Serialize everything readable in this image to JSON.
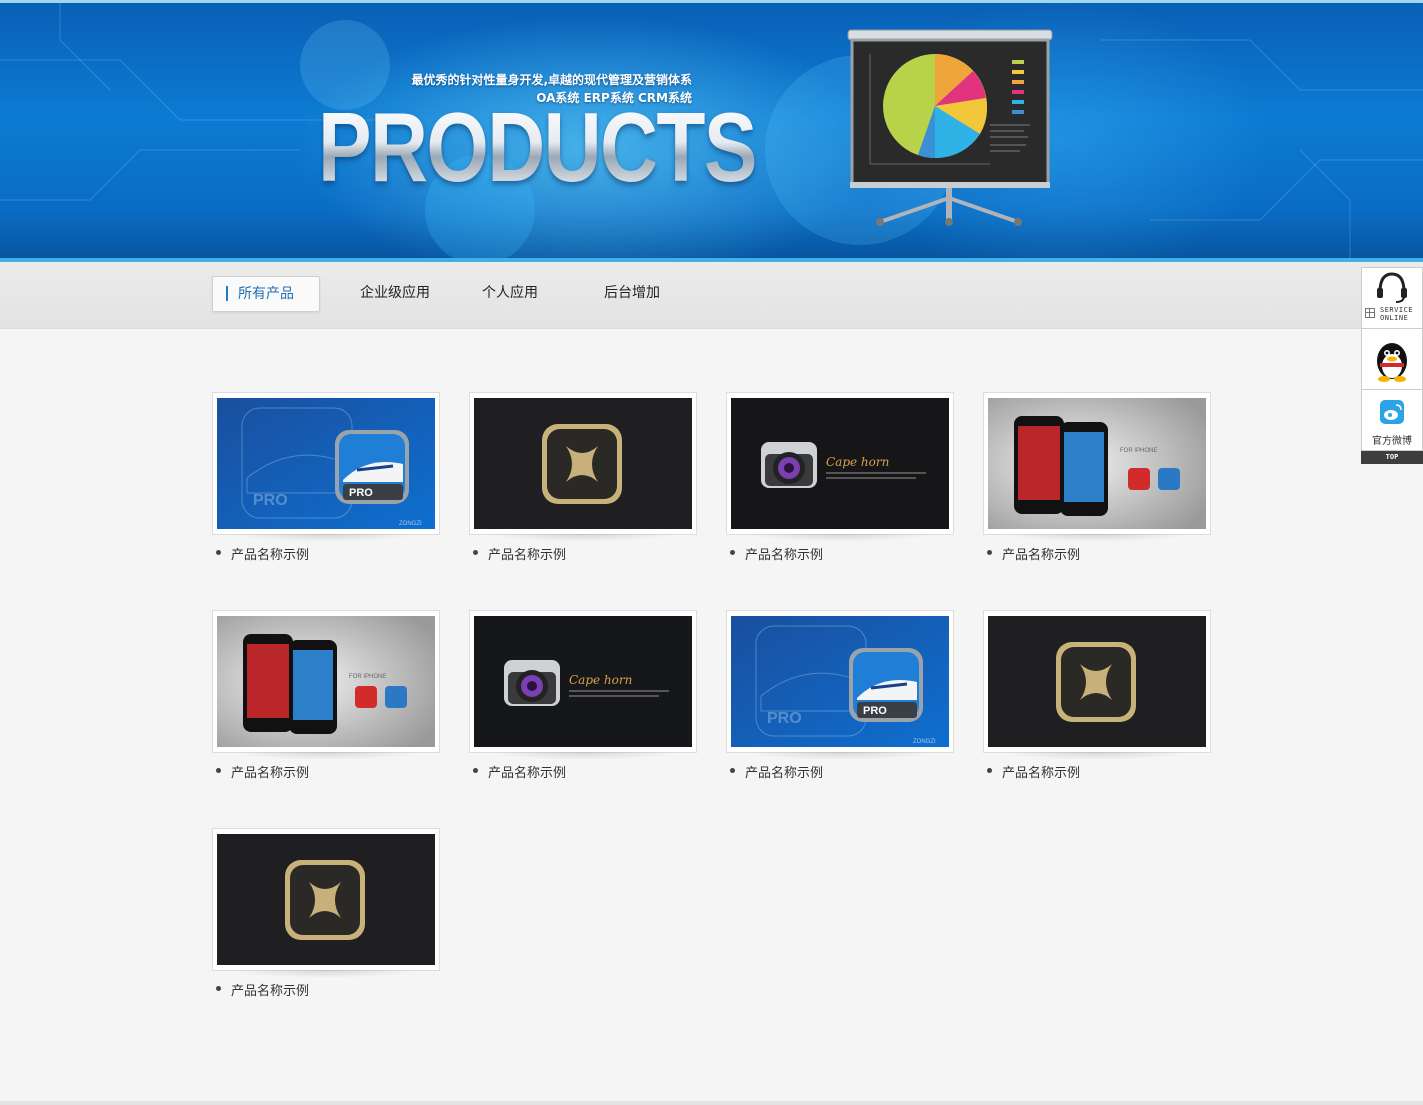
{
  "banner": {
    "tagline_line1": "最优秀的针对性量身开发,卓越的现代管理及营销体系",
    "tagline_line2": "OA系统 ERP系统 CRM系统",
    "title": "PRODUCTS",
    "illustration": "projector-pie-chart"
  },
  "nav": {
    "items": [
      {
        "label": "所有产品",
        "active": true
      },
      {
        "label": "企业级应用",
        "active": false
      },
      {
        "label": "个人应用",
        "active": false
      },
      {
        "label": "后台增加",
        "active": false
      }
    ]
  },
  "products": [
    {
      "name": "产品名称示例",
      "image": "train-app-icon"
    },
    {
      "name": "产品名称示例",
      "image": "gold-bow-app-icon"
    },
    {
      "name": "产品名称示例",
      "image": "camera-app-icon"
    },
    {
      "name": "产品名称示例",
      "image": "iphone-mockup"
    },
    {
      "name": "产品名称示例",
      "image": "iphone-mockup"
    },
    {
      "name": "产品名称示例",
      "image": "camera-app-icon"
    },
    {
      "name": "产品名称示例",
      "image": "train-app-icon"
    },
    {
      "name": "产品名称示例",
      "image": "gold-bow-app-icon"
    },
    {
      "name": "产品名称示例",
      "image": "gold-bow-app-icon"
    }
  ],
  "thumb_text": {
    "pro_badge": "PRO",
    "watermark": "ZONGZI",
    "camera_brand": "Cape horn",
    "phone_caption": "FOR IPHONE"
  },
  "side_widget": {
    "service_line1": "SERVICE",
    "service_line2": "ONLINE",
    "weibo_label": "官方微博",
    "top_label": "TOP",
    "icons": [
      "headset-icon",
      "qq-penguin-icon",
      "weibo-icon"
    ]
  },
  "colors": {
    "banner_blue": "#0c7bd3",
    "nav_active_text": "#1f6fb5",
    "page_bg": "#f5f5f5"
  }
}
